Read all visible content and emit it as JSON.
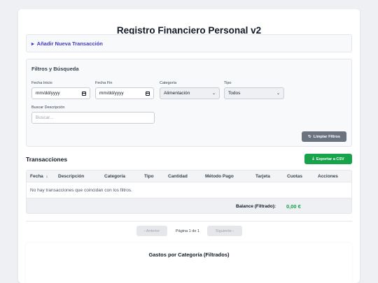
{
  "app": {
    "title": "Registro Financiero Personal v2"
  },
  "add_transaction": {
    "summary": "Añadir Nueva Transacción",
    "marker": "▸"
  },
  "filters": {
    "title": "Filtros y Búsqueda",
    "start_date": {
      "label": "Fecha Inicio",
      "value": "mm/dd/yyyy"
    },
    "end_date": {
      "label": "Fecha Fin",
      "value": "mm/dd/yyyy"
    },
    "category": {
      "label": "Categoría",
      "value": "Alimentación"
    },
    "type": {
      "label": "Tipo",
      "value": "Todos"
    },
    "search": {
      "label": "Buscar Descripción",
      "placeholder": "Buscar..."
    },
    "clear_button": "Limpiar Filtros"
  },
  "transactions": {
    "title": "Transacciones",
    "export_button": "Exportar a CSV",
    "columns": [
      "Fecha",
      "Descripción",
      "Categoría",
      "Tipo",
      "Cantidad",
      "Método Pago",
      "Tarjeta",
      "Cuotas",
      "Acciones"
    ],
    "sort_indicator": "↓",
    "empty_message": "No hay transacciones que coincidan con los filtros.",
    "balance_label": "Balance (Filtrado):",
    "balance_value": "0,00 €"
  },
  "pagination": {
    "prev": "‹ Anterior",
    "info": "Página 1 de 1",
    "next": "Siguiente ›"
  },
  "chart": {
    "title": "Gastos por Categoría (Filtrados)"
  },
  "colors": {
    "accent": "#4338ca",
    "success": "#16a34a",
    "neutral_button": "#6b7280"
  }
}
